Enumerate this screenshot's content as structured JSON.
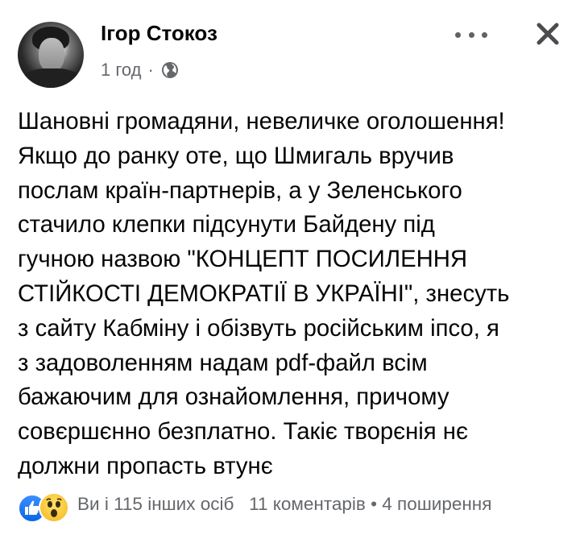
{
  "post": {
    "author": "Ігор Стокоз",
    "time": "1 год",
    "time_separator": "·",
    "audience_icon": "globe-icon",
    "text": "Шановні громадяни, невеличке оголошення!\nЯкщо до ранку оте, що Шмигаль вручив\nпослам країн-партнерів, а у Зеленського\nстачило клепки підсунути Байдену  під\nгучною назвою \"КОНЦЕПТ ПОСИЛЕННЯ\nСТІЙКОСТІ ДЕМОКРАТІЇ В УКРАЇНІ\", знесуть\nз сайту Кабміну і обізвуть російським іпсо, я\nз задоволенням надам pdf-файл всім\nбажаючим для ознайомлення, причому\nсовєршєнно безплатно. Такіє творєнія нє\nдолжни пропасть втунє"
  },
  "footer": {
    "reactions_summary": "Ви і 115 інших осіб",
    "comments": "11 коментарів",
    "separator": "•",
    "shares": "4 поширення",
    "reaction_icons": [
      "like-icon",
      "wow-icon"
    ]
  },
  "colors": {
    "text": "#050505",
    "secondary": "#65676b",
    "like_blue": "#0a66e8",
    "wow_yellow": "#f5b419"
  }
}
